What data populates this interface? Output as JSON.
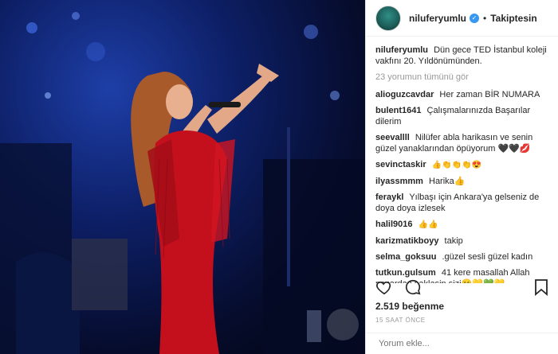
{
  "photo": {
    "alt": "singer on stage"
  },
  "header": {
    "username": "niluferyumlu",
    "follow_label": "Takiptesin"
  },
  "caption": {
    "user": "niluferyumlu",
    "text": "Dün gece TED İstanbul koleji vakfını 20. Yıldönümünden."
  },
  "view_all": "23 yorumun tümünü gör",
  "comments": [
    {
      "user": "alioguzcavdar",
      "text": "Her zaman BİR NUMARA"
    },
    {
      "user": "bulent1641",
      "text": "Çalışmalarınızda Başarılar dilerim"
    },
    {
      "user": "seevallll",
      "text": "Nilüfer abla harikasın ve senin güzel yanaklarından öpüyorum 🖤🖤💋"
    },
    {
      "user": "sevinctaskir",
      "text": "👍👏👏👏😍"
    },
    {
      "user": "ilyassmmm",
      "text": "Harika👍"
    },
    {
      "user": "feraykl",
      "text": "Yılbaşı için Ankara'ya gelseniz de doya doya izlesek"
    },
    {
      "user": "halil9016",
      "text": "👍👍"
    },
    {
      "user": "karizmatikboyy",
      "text": "takip"
    },
    {
      "user": "selma_goksuu",
      "text": ".güzel sesli güzel kadın"
    },
    {
      "user": "tutkun.gulsum",
      "text": "41 kere masallah Allah nazardan saklasin sizi😊💛💚💛"
    }
  ],
  "likes": "2.519 beğenme",
  "time": "15 SAAT ÖNCE",
  "comment_input": {
    "placeholder": "Yorum ekle..."
  },
  "icons": [
    "heart-icon",
    "comment-bubble-icon",
    "bookmark-icon",
    "verified-icon"
  ]
}
